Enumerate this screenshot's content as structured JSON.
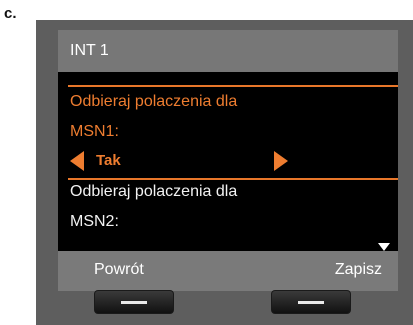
{
  "figure_label": "c.",
  "screen": {
    "title": "INT 1",
    "rows": [
      {
        "line1": "Odbieraj polaczenia dla",
        "line2": "MSN1:"
      },
      {
        "line1": "Odbieraj polaczenia dla",
        "line2": "MSN2:"
      }
    ],
    "option_value": "Tak"
  },
  "softkeys": {
    "left_label": "Powrót",
    "right_label": "Zapisz"
  },
  "colors": {
    "accent": "#ee7d30",
    "screen_bg": "#000000",
    "bar_bg": "#777777",
    "device_bg": "#5e5e5e"
  }
}
